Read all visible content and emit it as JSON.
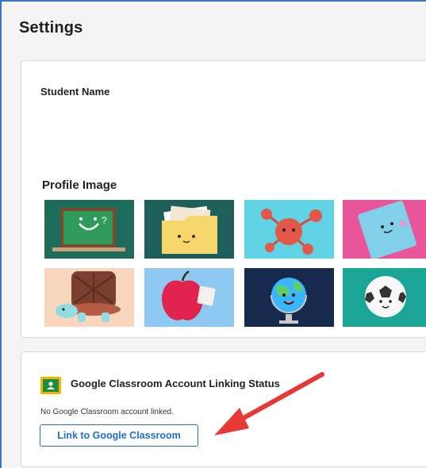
{
  "page": {
    "title": "Settings"
  },
  "profile_card": {
    "student_name_label": "Student Name",
    "profile_image_label": "Profile Image",
    "images": [
      {
        "icon": "chalkboard-icon",
        "bg": "#1d6b5a"
      },
      {
        "icon": "folder-icon",
        "bg": "#1f5f59"
      },
      {
        "icon": "molecule-icon",
        "bg": "#5fd3e3"
      },
      {
        "icon": "notebook-icon",
        "bg": "#e9559b"
      },
      {
        "icon": "turtle-icon",
        "bg": "#f8d5bd"
      },
      {
        "icon": "apple-icon",
        "bg": "#8ec9f2"
      },
      {
        "icon": "globe-icon",
        "bg": "#172a4e"
      },
      {
        "icon": "soccer-ball-icon",
        "bg": "#1aa596"
      }
    ]
  },
  "classroom_card": {
    "icon": "google-classroom-icon",
    "heading": "Google Classroom Account Linking Status",
    "status_text": "No Google Classroom account linked.",
    "link_button_label": "Link to Google Classroom"
  },
  "annotation": {
    "arrow_color": "#e53935"
  }
}
